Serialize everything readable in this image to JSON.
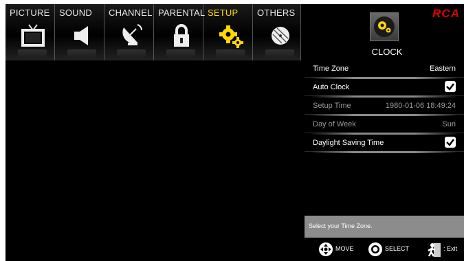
{
  "menu": {
    "tabs": [
      {
        "label": "PICTURE",
        "icon": "tv-icon"
      },
      {
        "label": "SOUND",
        "icon": "speaker-icon"
      },
      {
        "label": "CHANNEL",
        "icon": "satellite-dish-icon"
      },
      {
        "label": "PARENTAL",
        "icon": "lock-icon"
      },
      {
        "label": "SETUP",
        "icon": "gears-icon",
        "active": true
      },
      {
        "label": "OTHERS",
        "icon": "disc-icon"
      }
    ],
    "active_color": "#ffd800"
  },
  "header": {
    "section_title": "CLOCK",
    "section_icon": "gears-icon",
    "brand": "RCA",
    "brand_color": "#e00000"
  },
  "settings": {
    "rows": [
      {
        "label": "Time Zone",
        "value": "Eastern",
        "enabled": true
      },
      {
        "label": "Auto Clock",
        "checked": true,
        "enabled": true
      },
      {
        "label": "Setup Time",
        "value": "1980-01-06 18:49:24",
        "enabled": false
      },
      {
        "label": "Day of Week",
        "value": "Sun",
        "enabled": false
      },
      {
        "label": "Daylight Saving Time",
        "checked": true,
        "enabled": true
      }
    ]
  },
  "help": {
    "text": "Select your Time Zone."
  },
  "footer": {
    "move_label": "MOVE",
    "move_icon": "dpad-icon",
    "select_label": "SELECT",
    "select_icon": "ok-button-icon",
    "exit_label": ": Exit",
    "exit_icon": "exit-door-icon"
  }
}
